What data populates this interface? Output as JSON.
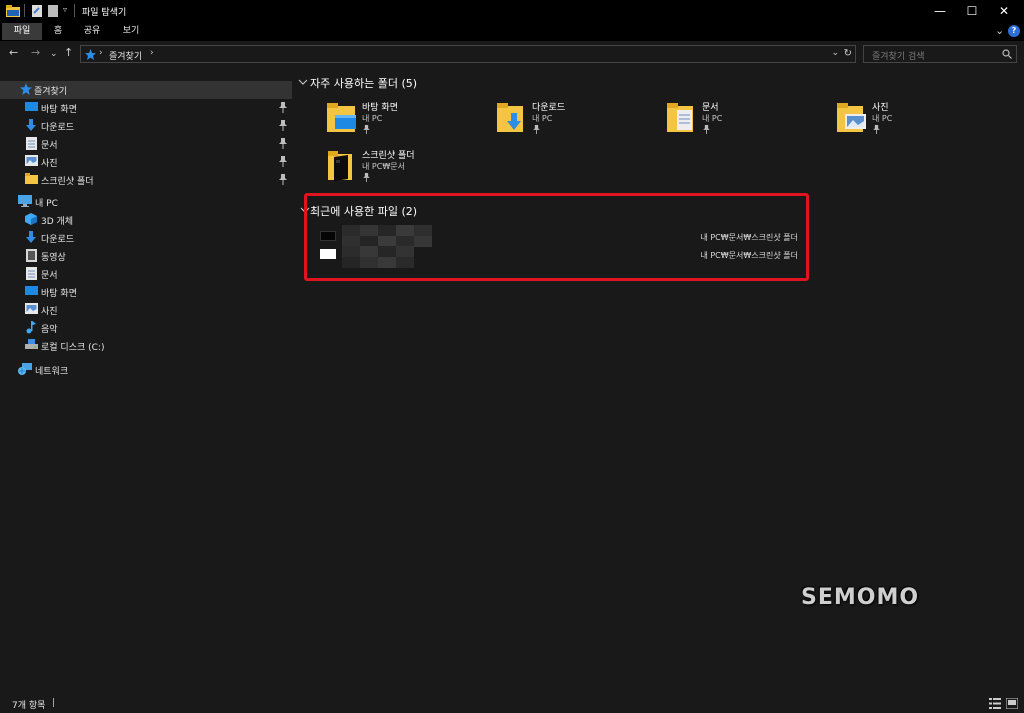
{
  "window": {
    "title": "파일 탐색기",
    "minimize_glyph": "—",
    "maximize_glyph": "☐",
    "close_glyph": "✕"
  },
  "ribbon": {
    "tabs": [
      "파일",
      "홈",
      "공유",
      "보기"
    ],
    "active_tab": "파일",
    "expand_glyph": "⌄",
    "help_glyph": "?"
  },
  "nav": {
    "back": "←",
    "forward": "→",
    "recent": "⌄",
    "up": "↑"
  },
  "address": {
    "separator": "›",
    "crumb": "즐겨찾기",
    "trailing_separator": "›",
    "dropdown_glyph": "⌄",
    "refresh_glyph": "↻"
  },
  "search": {
    "placeholder": "즐겨찾기 검색"
  },
  "sidebar": {
    "quick_access": {
      "label": "즐겨찾기",
      "items": [
        {
          "label": "바탕 화면",
          "icon": "desktop-icon",
          "pinned": true
        },
        {
          "label": "다운로드",
          "icon": "download-icon",
          "pinned": true
        },
        {
          "label": "문서",
          "icon": "document-icon",
          "pinned": true
        },
        {
          "label": "사진",
          "icon": "picture-icon",
          "pinned": true
        },
        {
          "label": "스크린샷 폴더",
          "icon": "folder-icon",
          "pinned": true
        }
      ]
    },
    "this_pc": {
      "label": "내 PC",
      "items": [
        {
          "label": "3D 개체",
          "icon": "cube-icon"
        },
        {
          "label": "다운로드",
          "icon": "download-icon"
        },
        {
          "label": "동영상",
          "icon": "video-icon"
        },
        {
          "label": "문서",
          "icon": "document-icon"
        },
        {
          "label": "바탕 화면",
          "icon": "desktop-icon"
        },
        {
          "label": "사진",
          "icon": "picture-icon"
        },
        {
          "label": "음악",
          "icon": "music-icon"
        },
        {
          "label": "로컬 디스크 (C:)",
          "icon": "drive-icon"
        }
      ]
    },
    "network": {
      "label": "네트워크"
    }
  },
  "main": {
    "frequent": {
      "header": "자주 사용하는 폴더 (5)",
      "folders": [
        {
          "name": "바탕 화면",
          "location": "내 PC",
          "overlay": "desktop"
        },
        {
          "name": "다운로드",
          "location": "내 PC",
          "overlay": "download"
        },
        {
          "name": "문서",
          "location": "내 PC",
          "overlay": "document"
        },
        {
          "name": "사진",
          "location": "내 PC",
          "overlay": "picture"
        },
        {
          "name": "스크린샷 폴더",
          "location": "내 PC₩문서",
          "overlay": "screenshot"
        }
      ]
    },
    "recent": {
      "header": "최근에 사용한 파일 (2)",
      "files": [
        {
          "name": "",
          "path": "내 PC₩문서₩스크린샷 폴더",
          "thumb": "#050505"
        },
        {
          "name": "",
          "path": "내 PC₩문서₩스크린샷 폴더",
          "thumb": "#ffffff"
        }
      ]
    }
  },
  "watermark": "SEMOMO",
  "status": {
    "item_count": "7개 항목",
    "cursor": "|"
  },
  "colors": {
    "highlight_box": "#e0141e",
    "folder_yellow": "#f4c542",
    "accent_blue": "#2d8ce6"
  }
}
